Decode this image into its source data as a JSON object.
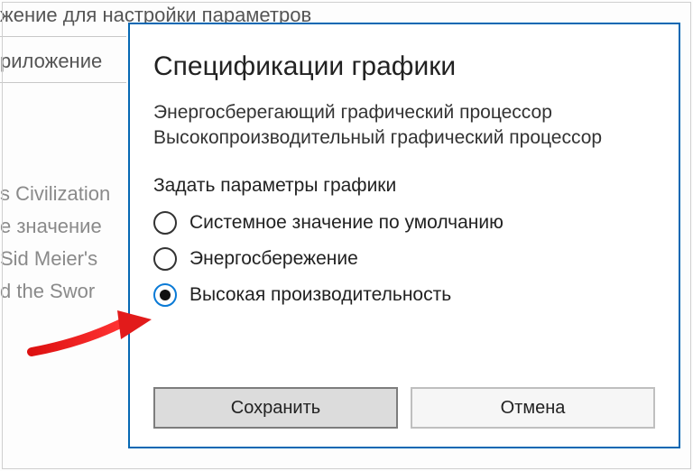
{
  "background": {
    "line1": "жение для настройки параметров",
    "line2": "риложение",
    "list": [
      "s Civilization",
      "е значение",
      "Sid Meier's",
      "d the Swor"
    ]
  },
  "dialog": {
    "title": "Спецификации графики",
    "info_line1": "Энергосберегающий графический процессор",
    "info_line2": "Высокопроизводительный графический процессор",
    "section_label": "Задать параметры графики",
    "options": [
      {
        "label": "Системное значение по умолчанию",
        "selected": false
      },
      {
        "label": "Энергосбережение",
        "selected": false
      },
      {
        "label": "Высокая производительность",
        "selected": true
      }
    ],
    "save_label": "Сохранить",
    "cancel_label": "Отмена"
  }
}
